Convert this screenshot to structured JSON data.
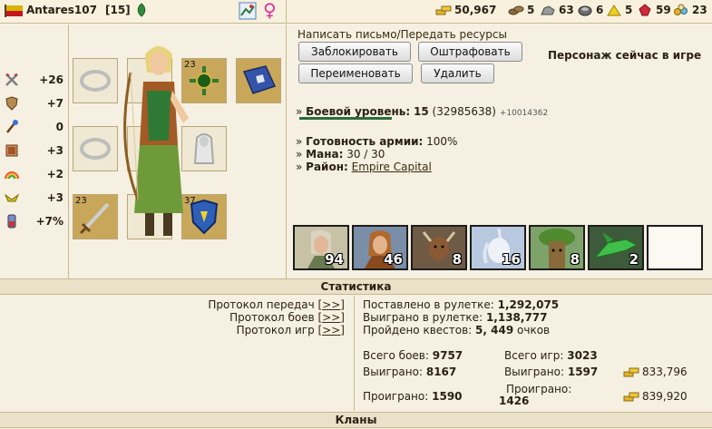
{
  "player": {
    "name": "Antares107",
    "level": "[15]"
  },
  "resources": [
    {
      "name": "gold-icon",
      "value": "50,967",
      "color": "#d6a821"
    },
    {
      "name": "wood-icon",
      "value": "5",
      "color": "#8a6a3c"
    },
    {
      "name": "ore-icon",
      "value": "63",
      "color": "#8c8c8c"
    },
    {
      "name": "mercury-icon",
      "value": "6",
      "color": "#7a7a7a"
    },
    {
      "name": "sulfur-icon",
      "value": "5",
      "color": "#e8c41a"
    },
    {
      "name": "crystal-icon",
      "value": "59",
      "color": "#c8283a"
    },
    {
      "name": "gems-icon",
      "value": "23",
      "color": "#e5a920"
    }
  ],
  "stats": [
    {
      "icon": "attack-icon",
      "value": "+26"
    },
    {
      "icon": "defense-icon",
      "value": "+7"
    },
    {
      "icon": "spellpower-icon",
      "value": "0"
    },
    {
      "icon": "knowledge-icon",
      "value": "+3"
    },
    {
      "icon": "luck-icon",
      "value": "+2"
    },
    {
      "icon": "morale-icon",
      "value": "+3"
    },
    {
      "icon": "initiative-icon",
      "value": "+7%"
    }
  ],
  "equipment": {
    "amulet_level": "23",
    "weapon_level": "23",
    "shield_level": "37"
  },
  "actions": {
    "write_letter": "Написать письмо/Передать ресурсы",
    "block": "Заблокировать",
    "fine": "Оштрафовать",
    "rename": "Переименовать",
    "delete": "Удалить",
    "online_status": "Персонаж сейчас в игре"
  },
  "info": {
    "combat_level_label": "Боевой уровень:",
    "combat_level_value": "15",
    "experience": "(32985638)",
    "experience_extra": "+10014362",
    "army_ready_label": "Готовность армии:",
    "army_ready_value": "100%",
    "mana_label": "Мана:",
    "mana_value": "30 / 30",
    "district_label": "Район:",
    "district_value": "Empire Capital"
  },
  "army": [
    {
      "name": "elf-archer-unit",
      "count": "94"
    },
    {
      "name": "druid-unit",
      "count": "46"
    },
    {
      "name": "centaur-unit",
      "count": "8"
    },
    {
      "name": "unicorn-unit",
      "count": "16"
    },
    {
      "name": "treant-unit",
      "count": "8"
    },
    {
      "name": "green-dragon-unit",
      "count": "2"
    },
    {
      "name": "empty-unit-slot",
      "count": ""
    }
  ],
  "statistics": {
    "header": "Статистика",
    "protocols": [
      {
        "label": "Протокол передач",
        "link": "[>>]"
      },
      {
        "label": "Протокол боев",
        "link": "[>>]"
      },
      {
        "label": "Протокол игр",
        "link": "[>>]"
      }
    ],
    "roulette_bet_label": "Поставлено в рулетке:",
    "roulette_bet_value": "1,292,075",
    "roulette_won_label": "Выиграно в рулетке:",
    "roulette_won_value": "1,138,777",
    "quests_label": "Пройдено квестов:",
    "quests_value": "5, 449",
    "quests_unit": "очков",
    "total_battles_label": "Всего боев:",
    "total_battles_value": "9757",
    "battles_won_label": "Выиграно:",
    "battles_won_value": "8167",
    "battles_lost_label": "Проиграно:",
    "battles_lost_value": "1590",
    "total_games_label": "Всего игр:",
    "total_games_value": "3023",
    "games_won_label": "Выиграно:",
    "games_won_value": "1597",
    "games_lost_label": "Проиграно:",
    "games_lost_value": "1426",
    "gold_won": "833,796",
    "gold_lost": "839,920"
  },
  "clans": {
    "header": "Кланы"
  }
}
